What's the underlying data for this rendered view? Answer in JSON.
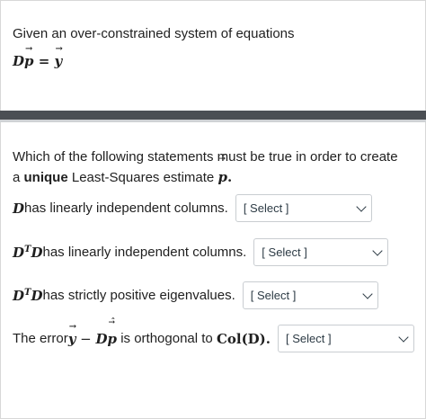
{
  "question1": {
    "text": "Given an over-constrained system of equations",
    "equation_lhs": "D",
    "equation_vec_p": "p",
    "equation_op": " = ",
    "equation_vec_y": "y"
  },
  "question2": {
    "intro_before": "Which of the following statements must be true in order to create a ",
    "intro_bold": "unique",
    "intro_after": " Least-Squares estimate ",
    "estimate_symbol": "p",
    "estimate_end": "."
  },
  "statements": [
    {
      "math": "D",
      "sup": "",
      "text": " has linearly independent columns.",
      "select_value": "[ Select ]"
    },
    {
      "math": "D",
      "sup": "T",
      "math2": "D",
      "text": " has linearly independent columns.",
      "select_value": "[ Select ]"
    },
    {
      "math": "D",
      "sup": "T",
      "math2": "D",
      "text": " has strictly positive eigenvalues.",
      "select_value": "[ Select ]"
    },
    {
      "prefix": "The error ",
      "vec_y": "y",
      "minus": " − ",
      "D": "D",
      "vec_p": "p",
      "middle": " is orthogonal to ",
      "col": "Col(D).",
      "select_value": "[ Select ]"
    }
  ],
  "icons": {
    "dropdown": "chevron-down-icon"
  }
}
